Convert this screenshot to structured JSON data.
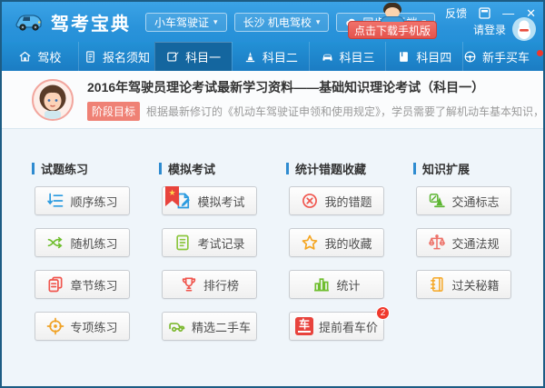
{
  "titlebar": {
    "app_title": "驾考宝典",
    "license_dropdown": "小车驾驶证",
    "school_dropdown": "长沙 机电驾校",
    "sync_dropdown": "同步到云端",
    "download_button": "点击下载手机版",
    "feedback": "反馈",
    "login": "请登录"
  },
  "nav": {
    "active_tab": "科目一",
    "tabs": [
      {
        "label": "驾校"
      },
      {
        "label": "报名须知"
      },
      {
        "label": "科目一"
      },
      {
        "label": "科目二"
      },
      {
        "label": "科目三"
      },
      {
        "label": "科目四"
      },
      {
        "label": "新手买车",
        "has_red_dot": true
      }
    ]
  },
  "banner": {
    "title": "2016年驾驶员理论考试最新学习资料——基础知识理论考试（科目一）",
    "badge": "阶段目标",
    "description": "根据最新修订的《机动车驾驶证申领和使用规定》，学员需要了解机动车基本知识，掌握道路交通安全法律、法规及道路交通。"
  },
  "sections": [
    {
      "title": "试题练习",
      "buttons": [
        {
          "label": "顺序练习"
        },
        {
          "label": "随机练习"
        },
        {
          "label": "章节练习"
        },
        {
          "label": "专项练习"
        }
      ]
    },
    {
      "title": "模拟考试",
      "buttons": [
        {
          "label": "模拟考试"
        },
        {
          "label": "考试记录"
        },
        {
          "label": "排行榜"
        },
        {
          "label": "精选二手车"
        }
      ]
    },
    {
      "title": "统计错题收藏",
      "buttons": [
        {
          "label": "我的错题"
        },
        {
          "label": "我的收藏"
        },
        {
          "label": "统计"
        },
        {
          "label": "提前看车价",
          "badge": "2"
        }
      ]
    },
    {
      "title": "知识扩展",
      "buttons": [
        {
          "label": "交通标志"
        },
        {
          "label": "交通法规"
        },
        {
          "label": "过关秘籍"
        }
      ]
    }
  ],
  "glyphs": {
    "caret": "▾",
    "minimize": "—",
    "close": "✕",
    "star": "★",
    "car_char": "车"
  },
  "icons": {
    "logo": "blue-sports-car",
    "sync": "cloud-icon",
    "login_avatar": "qq-penguin-icon",
    "tabs": [
      "home-icon",
      "document-icon",
      "edit-icon",
      "traffic-cone-icon",
      "car-icon",
      "book-icon",
      "steering-wheel-icon"
    ],
    "buttons": [
      "ordered-list-icon",
      "shuffle-icon",
      "copy-pages-icon",
      "target-icon",
      "doc-pencil-icon",
      "record-doc-icon",
      "trophy-icon",
      "truck-icon",
      "circle-x-icon",
      "star-outline-icon",
      "bar-chart-icon",
      "car-price-icon",
      "traffic-sign-icon",
      "scales-icon",
      "secret-book-icon"
    ]
  },
  "colors": {
    "titlebar": "#2f9bdf",
    "navbar": "#1e84cb",
    "active_tab": "#14669f",
    "download_red": "#e9544c",
    "stage_badge": "#ef8175",
    "accent_blue": "#2e8bd0",
    "content_bg": "#eff5fa",
    "icon_red": "#f0554d",
    "icon_green": "#6fbe2e",
    "icon_orange": "#f5a623",
    "icon_blue": "#2b9be0"
  }
}
